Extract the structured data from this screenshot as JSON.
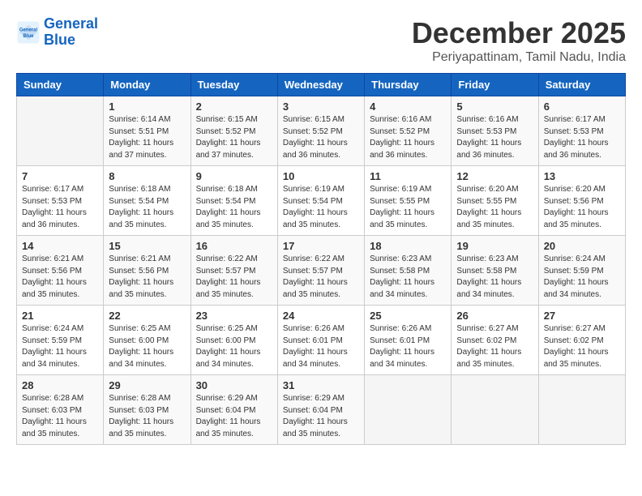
{
  "logo": {
    "line1": "General",
    "line2": "Blue"
  },
  "title": "December 2025",
  "subtitle": "Periyapattinam, Tamil Nadu, India",
  "weekdays": [
    "Sunday",
    "Monday",
    "Tuesday",
    "Wednesday",
    "Thursday",
    "Friday",
    "Saturday"
  ],
  "weeks": [
    [
      {
        "day": "",
        "sunrise": "",
        "sunset": "",
        "daylight": ""
      },
      {
        "day": "1",
        "sunrise": "Sunrise: 6:14 AM",
        "sunset": "Sunset: 5:51 PM",
        "daylight": "Daylight: 11 hours and 37 minutes."
      },
      {
        "day": "2",
        "sunrise": "Sunrise: 6:15 AM",
        "sunset": "Sunset: 5:52 PM",
        "daylight": "Daylight: 11 hours and 37 minutes."
      },
      {
        "day": "3",
        "sunrise": "Sunrise: 6:15 AM",
        "sunset": "Sunset: 5:52 PM",
        "daylight": "Daylight: 11 hours and 36 minutes."
      },
      {
        "day": "4",
        "sunrise": "Sunrise: 6:16 AM",
        "sunset": "Sunset: 5:52 PM",
        "daylight": "Daylight: 11 hours and 36 minutes."
      },
      {
        "day": "5",
        "sunrise": "Sunrise: 6:16 AM",
        "sunset": "Sunset: 5:53 PM",
        "daylight": "Daylight: 11 hours and 36 minutes."
      },
      {
        "day": "6",
        "sunrise": "Sunrise: 6:17 AM",
        "sunset": "Sunset: 5:53 PM",
        "daylight": "Daylight: 11 hours and 36 minutes."
      }
    ],
    [
      {
        "day": "7",
        "sunrise": "Sunrise: 6:17 AM",
        "sunset": "Sunset: 5:53 PM",
        "daylight": "Daylight: 11 hours and 36 minutes."
      },
      {
        "day": "8",
        "sunrise": "Sunrise: 6:18 AM",
        "sunset": "Sunset: 5:54 PM",
        "daylight": "Daylight: 11 hours and 35 minutes."
      },
      {
        "day": "9",
        "sunrise": "Sunrise: 6:18 AM",
        "sunset": "Sunset: 5:54 PM",
        "daylight": "Daylight: 11 hours and 35 minutes."
      },
      {
        "day": "10",
        "sunrise": "Sunrise: 6:19 AM",
        "sunset": "Sunset: 5:54 PM",
        "daylight": "Daylight: 11 hours and 35 minutes."
      },
      {
        "day": "11",
        "sunrise": "Sunrise: 6:19 AM",
        "sunset": "Sunset: 5:55 PM",
        "daylight": "Daylight: 11 hours and 35 minutes."
      },
      {
        "day": "12",
        "sunrise": "Sunrise: 6:20 AM",
        "sunset": "Sunset: 5:55 PM",
        "daylight": "Daylight: 11 hours and 35 minutes."
      },
      {
        "day": "13",
        "sunrise": "Sunrise: 6:20 AM",
        "sunset": "Sunset: 5:56 PM",
        "daylight": "Daylight: 11 hours and 35 minutes."
      }
    ],
    [
      {
        "day": "14",
        "sunrise": "Sunrise: 6:21 AM",
        "sunset": "Sunset: 5:56 PM",
        "daylight": "Daylight: 11 hours and 35 minutes."
      },
      {
        "day": "15",
        "sunrise": "Sunrise: 6:21 AM",
        "sunset": "Sunset: 5:56 PM",
        "daylight": "Daylight: 11 hours and 35 minutes."
      },
      {
        "day": "16",
        "sunrise": "Sunrise: 6:22 AM",
        "sunset": "Sunset: 5:57 PM",
        "daylight": "Daylight: 11 hours and 35 minutes."
      },
      {
        "day": "17",
        "sunrise": "Sunrise: 6:22 AM",
        "sunset": "Sunset: 5:57 PM",
        "daylight": "Daylight: 11 hours and 35 minutes."
      },
      {
        "day": "18",
        "sunrise": "Sunrise: 6:23 AM",
        "sunset": "Sunset: 5:58 PM",
        "daylight": "Daylight: 11 hours and 34 minutes."
      },
      {
        "day": "19",
        "sunrise": "Sunrise: 6:23 AM",
        "sunset": "Sunset: 5:58 PM",
        "daylight": "Daylight: 11 hours and 34 minutes."
      },
      {
        "day": "20",
        "sunrise": "Sunrise: 6:24 AM",
        "sunset": "Sunset: 5:59 PM",
        "daylight": "Daylight: 11 hours and 34 minutes."
      }
    ],
    [
      {
        "day": "21",
        "sunrise": "Sunrise: 6:24 AM",
        "sunset": "Sunset: 5:59 PM",
        "daylight": "Daylight: 11 hours and 34 minutes."
      },
      {
        "day": "22",
        "sunrise": "Sunrise: 6:25 AM",
        "sunset": "Sunset: 6:00 PM",
        "daylight": "Daylight: 11 hours and 34 minutes."
      },
      {
        "day": "23",
        "sunrise": "Sunrise: 6:25 AM",
        "sunset": "Sunset: 6:00 PM",
        "daylight": "Daylight: 11 hours and 34 minutes."
      },
      {
        "day": "24",
        "sunrise": "Sunrise: 6:26 AM",
        "sunset": "Sunset: 6:01 PM",
        "daylight": "Daylight: 11 hours and 34 minutes."
      },
      {
        "day": "25",
        "sunrise": "Sunrise: 6:26 AM",
        "sunset": "Sunset: 6:01 PM",
        "daylight": "Daylight: 11 hours and 34 minutes."
      },
      {
        "day": "26",
        "sunrise": "Sunrise: 6:27 AM",
        "sunset": "Sunset: 6:02 PM",
        "daylight": "Daylight: 11 hours and 35 minutes."
      },
      {
        "day": "27",
        "sunrise": "Sunrise: 6:27 AM",
        "sunset": "Sunset: 6:02 PM",
        "daylight": "Daylight: 11 hours and 35 minutes."
      }
    ],
    [
      {
        "day": "28",
        "sunrise": "Sunrise: 6:28 AM",
        "sunset": "Sunset: 6:03 PM",
        "daylight": "Daylight: 11 hours and 35 minutes."
      },
      {
        "day": "29",
        "sunrise": "Sunrise: 6:28 AM",
        "sunset": "Sunset: 6:03 PM",
        "daylight": "Daylight: 11 hours and 35 minutes."
      },
      {
        "day": "30",
        "sunrise": "Sunrise: 6:29 AM",
        "sunset": "Sunset: 6:04 PM",
        "daylight": "Daylight: 11 hours and 35 minutes."
      },
      {
        "day": "31",
        "sunrise": "Sunrise: 6:29 AM",
        "sunset": "Sunset: 6:04 PM",
        "daylight": "Daylight: 11 hours and 35 minutes."
      },
      {
        "day": "",
        "sunrise": "",
        "sunset": "",
        "daylight": ""
      },
      {
        "day": "",
        "sunrise": "",
        "sunset": "",
        "daylight": ""
      },
      {
        "day": "",
        "sunrise": "",
        "sunset": "",
        "daylight": ""
      }
    ]
  ]
}
